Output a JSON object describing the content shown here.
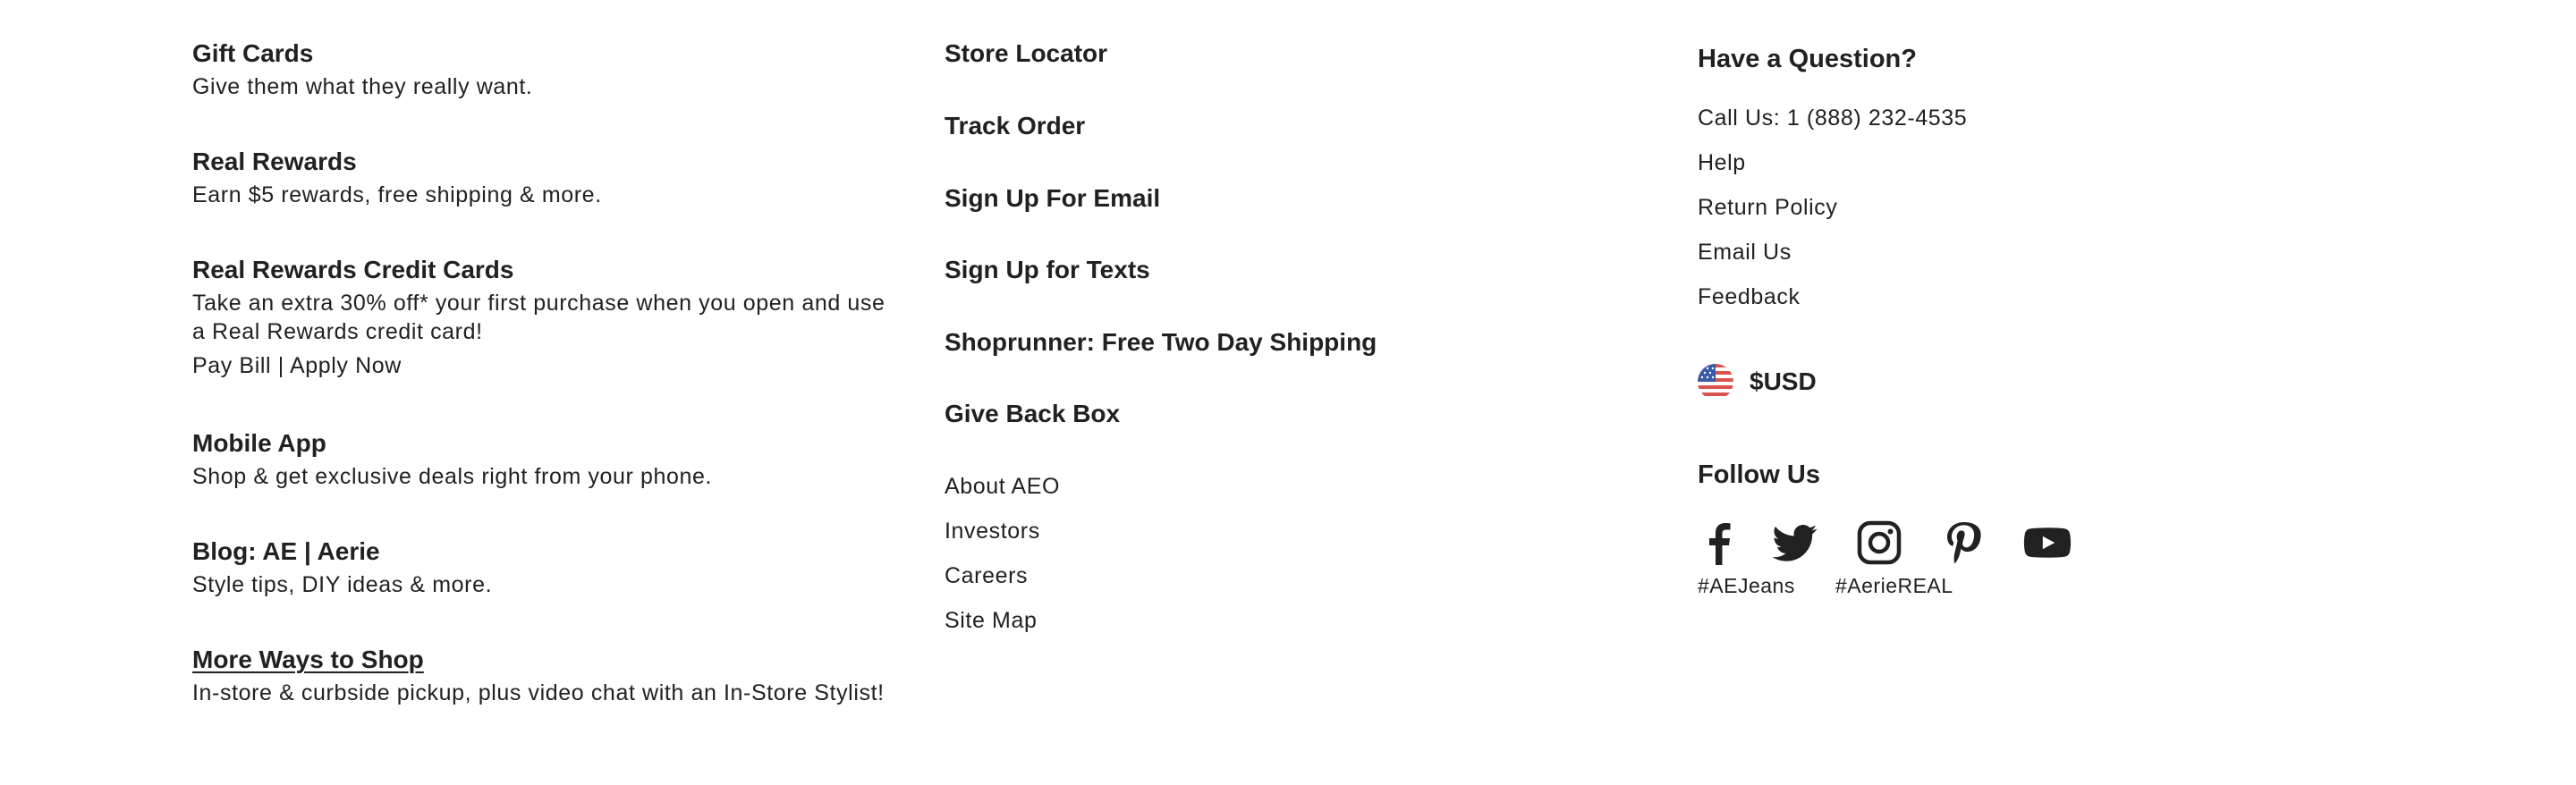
{
  "promos": [
    {
      "title": "Gift Cards",
      "description": "Give them what they really want."
    },
    {
      "title": "Real Rewards",
      "description": "Earn $5 rewards, free shipping & more."
    },
    {
      "title": "Real Rewards Credit Cards",
      "description_line1": "Take an extra 30% off* your first purchase when you open and use",
      "description_line2": "a Real Rewards credit card!",
      "pay_bill_label": "Pay Bill",
      "separator": "|",
      "apply_now_label": "Apply Now"
    },
    {
      "title": "Mobile App",
      "description": "Shop & get exclusive deals right from your phone."
    },
    {
      "title": "Blog: AE | Aerie",
      "description": "Style tips, DIY ideas & more."
    },
    {
      "title": "More Ways to Shop",
      "description": "In-store & curbside pickup, plus video chat with an In-Store Stylist!"
    }
  ],
  "quick_links": [
    "Store Locator",
    "Track Order",
    "Sign Up For Email",
    "Sign Up for Texts",
    "Shoprunner: Free Two Day Shipping",
    "Give Back Box"
  ],
  "company_links": [
    "About AEO",
    "Investors",
    "Careers",
    "Site Map"
  ],
  "support": {
    "heading": "Have a Question?",
    "links": [
      "Call Us: 1 (888) 232-4535",
      "Help",
      "Return Policy",
      "Email Us",
      "Feedback"
    ]
  },
  "currency": {
    "label": "$USD",
    "flag_icon": "us-flag-icon"
  },
  "social": {
    "heading": "Follow Us",
    "icons": [
      "facebook-icon",
      "twitter-icon",
      "instagram-icon",
      "pinterest-icon",
      "youtube-icon"
    ],
    "hashtags": [
      "#AEJeans",
      "#AerieREAL"
    ]
  },
  "colors": {
    "text": "#212121",
    "background": "#ffffff",
    "flag_red": "#d9534f",
    "flag_blue": "#3b5ba9"
  }
}
